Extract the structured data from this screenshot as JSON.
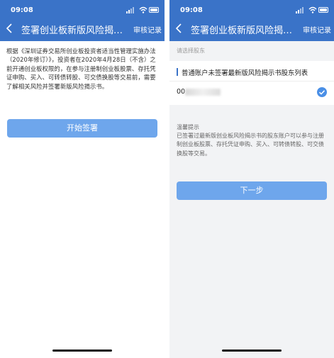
{
  "status_bar": {
    "time": "09:08"
  },
  "left_screen": {
    "nav": {
      "title": "签署创业板新版风险揭…",
      "action": "审核记录"
    },
    "body_text": "根据《深圳证券交易所创业板投资者适当性管理实施办法（2020年修订）》，投资者在2020年4月28日（不含）之前开通创业板权限的，在参与注册制创业板股票、存托凭证申购、买入、可转债转股、可交债换股等交易前，需要了解相关风险并签署新版风险揭示书。",
    "primary_button": "开始签署"
  },
  "right_screen": {
    "nav": {
      "title": "签署创业板新版风险揭…",
      "action": "审核记录"
    },
    "section_hint": "请选择股东",
    "card": {
      "title": "普通账户未签署最新版风险揭示书股东列表",
      "account_prefix": "00",
      "selected": true
    },
    "tip": {
      "title": "温馨提示",
      "text": "已签署过最新版创业板风险揭示书的股东账户可以参与注册制创业板股票、存托凭证申购、买入、可转债转股、可交债换股等交易。"
    },
    "primary_button": "下一步"
  },
  "colors": {
    "header_blue": "#3a73c8",
    "button_blue": "#6ea6ec",
    "check_blue": "#4a8fe6"
  },
  "icons": [
    "back-arrow-icon",
    "signal-icon",
    "wifi-icon",
    "battery-icon",
    "checkmark-icon"
  ]
}
